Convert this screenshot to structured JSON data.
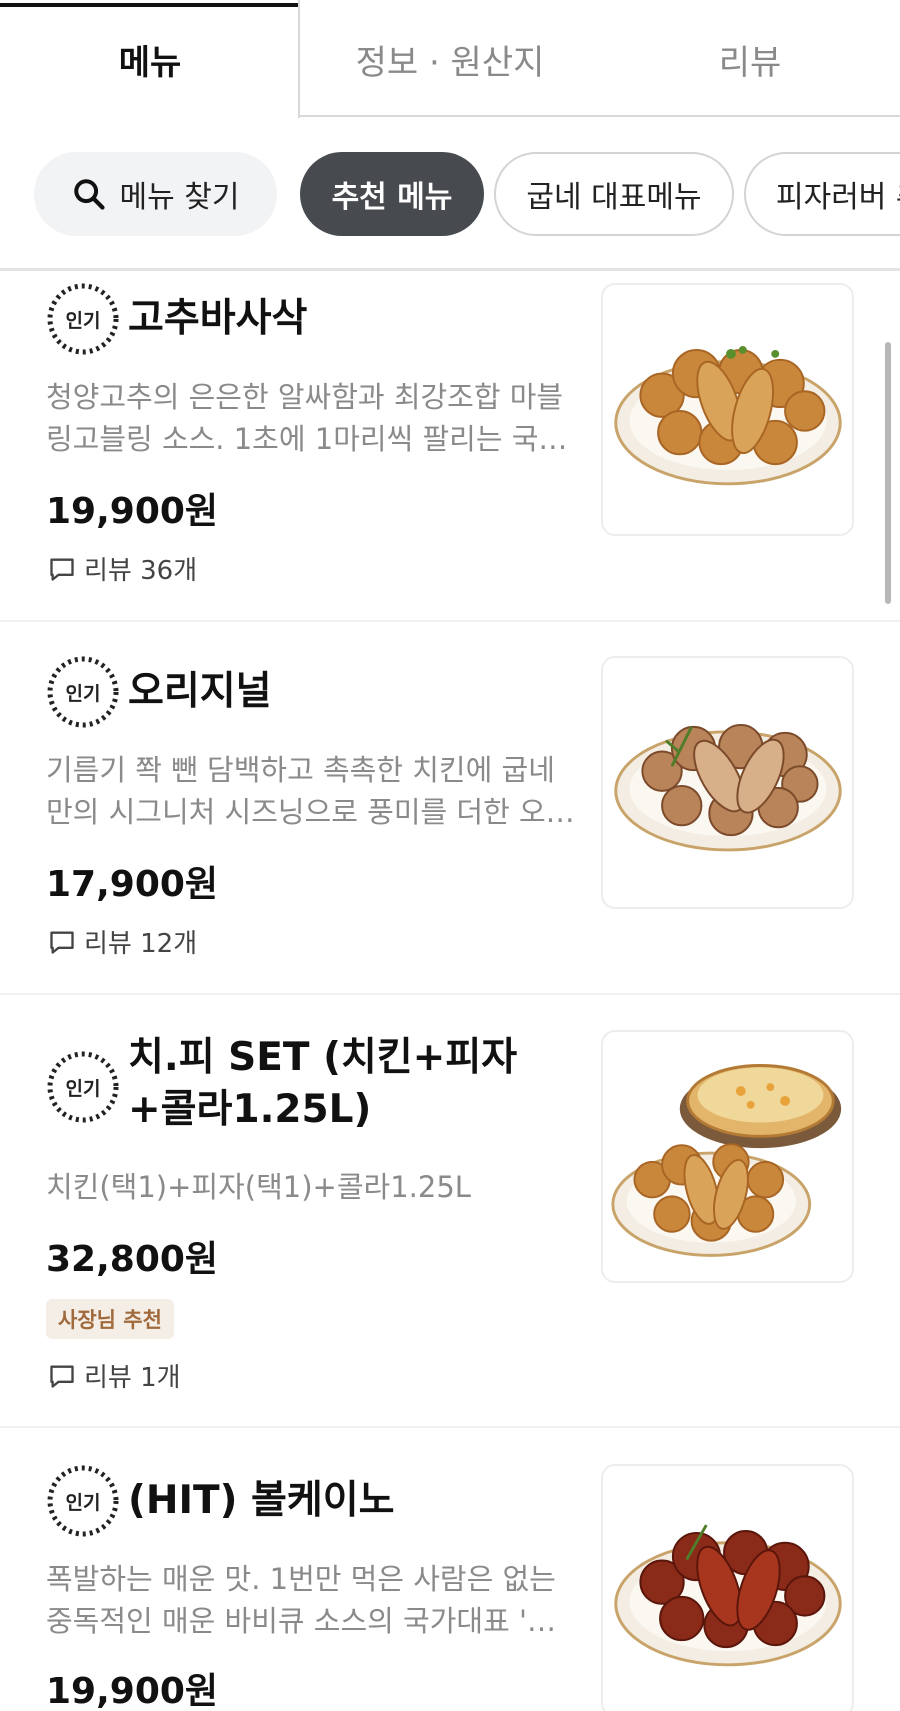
{
  "tabs": [
    {
      "label": "메뉴"
    },
    {
      "label": "정보 · 원산지"
    },
    {
      "label": "리뷰"
    }
  ],
  "chips": {
    "search_label": "메뉴 찾기",
    "items": [
      "추천 메뉴",
      "굽네 대표메뉴",
      "피자러버 추"
    ]
  },
  "badge_text": "인기",
  "menu_items": [
    {
      "name": "고추바사삭",
      "description": "청양고추의 은은한 알싸함과 최강조합 마블링고블링 소스. 1초에 1마리씩 팔리는 국…",
      "price": "19,900원",
      "review": "리뷰 36개"
    },
    {
      "name": "오리지널",
      "description": "기름기 쫙 뺀 담백하고 촉촉한 치킨에  굽네만의 시그니처 시즈닝으로 풍미를 더한 오…",
      "price": "17,900원",
      "review": "리뷰 12개"
    },
    {
      "name": "치.피 SET (치킨+피자+콜라1.25L)",
      "description": "치킨(택1)+피자(택1)+콜라1.25L",
      "price": "32,800원",
      "owner_badge": "사장님 추천",
      "review": "리뷰 1개"
    },
    {
      "name": "(HIT) 볼케이노",
      "description": "폭발하는 매운 맛. 1번만 먹은 사람은 없는 중독적인 매운 바비큐 소스의 국가대표 '…",
      "price": "19,900원"
    }
  ],
  "colors": {
    "active_chip": "#474a4e",
    "search_chip": "#f2f3f5",
    "owner_badge_bg": "#f4eee6",
    "owner_badge_text": "#a06a3c",
    "muted_text": "#8a8a8a"
  }
}
